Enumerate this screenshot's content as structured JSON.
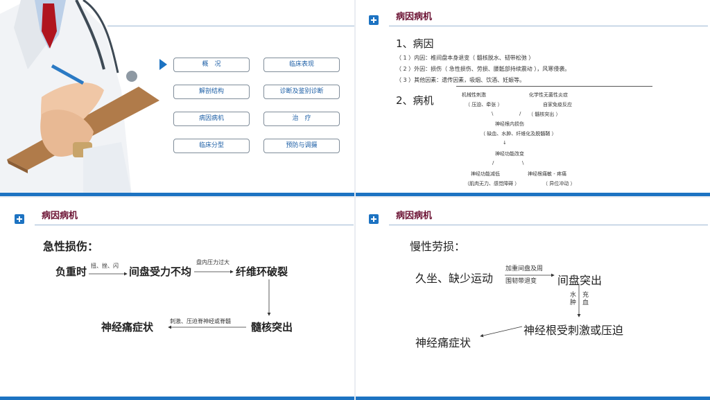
{
  "slide1": {
    "menu": [
      "概　况",
      "临床表现",
      "解剖结构",
      "诊断及鉴别诊断",
      "病因病机",
      "治　疗",
      "临床分型",
      "预防与调摄"
    ]
  },
  "slide2": {
    "title": "病因病机",
    "h1": "1、病因",
    "l1": "（ 1 ）内因：椎间盘本身退变（ 髓核脱水、韧带松弛 ）",
    "l2": "（ 2 ）外因：损伤（ 急性损伤、劳损、腰骶部持续震动 ），风寒侵袭。",
    "l3": "（ 3 ）其他因素：遗传因素，吸烟、饮酒、妊娠等。",
    "h2": "2、病机",
    "m1": "机械性刺激",
    "m2": "（ 压迫、牵张 ）",
    "m3": "化学性无菌性炎症",
    "m4": "自家免疫反应",
    "m5": "（ 髓核突出 ）",
    "m6": "神经根内损伤",
    "m7": "（ 缺血、水肿、纤维化及脱髓鞘 ）",
    "m8": "神经功能改变",
    "m9": "神经功能减低",
    "m10": "（肌肉无力、感觉障碍 ）",
    "m11": "神经根痛敏 - 疼痛",
    "m12": "（ 异位冲动 ）",
    "s1": "\\",
    "s2": "/",
    "s3": "↓",
    "s4": "/",
    "s5": "\\"
  },
  "slide3": {
    "title": "病因病机",
    "heading": "急性损伤：",
    "n1": "负重时",
    "e1": "扭、挫、闪",
    "n2": "间盘受力不均",
    "e2": "盘内压力过大",
    "n3": "纤维环破裂",
    "n4": "髓核突出",
    "e3": "刺激、压迫脊神经或脊髓",
    "n5": "神经痛症状"
  },
  "slide4": {
    "title": "病因病机",
    "heading": "慢性劳损：",
    "n1": "久坐、缺少运动",
    "e1a": "加重间盘及周",
    "e1b": "围韧带退变",
    "n2": "间盘突出",
    "v1a": "水",
    "v1b": "肿",
    "v2a": "充",
    "v2b": "血",
    "n3": "神经根受刺激或压迫",
    "n4": "神经痛症状"
  }
}
